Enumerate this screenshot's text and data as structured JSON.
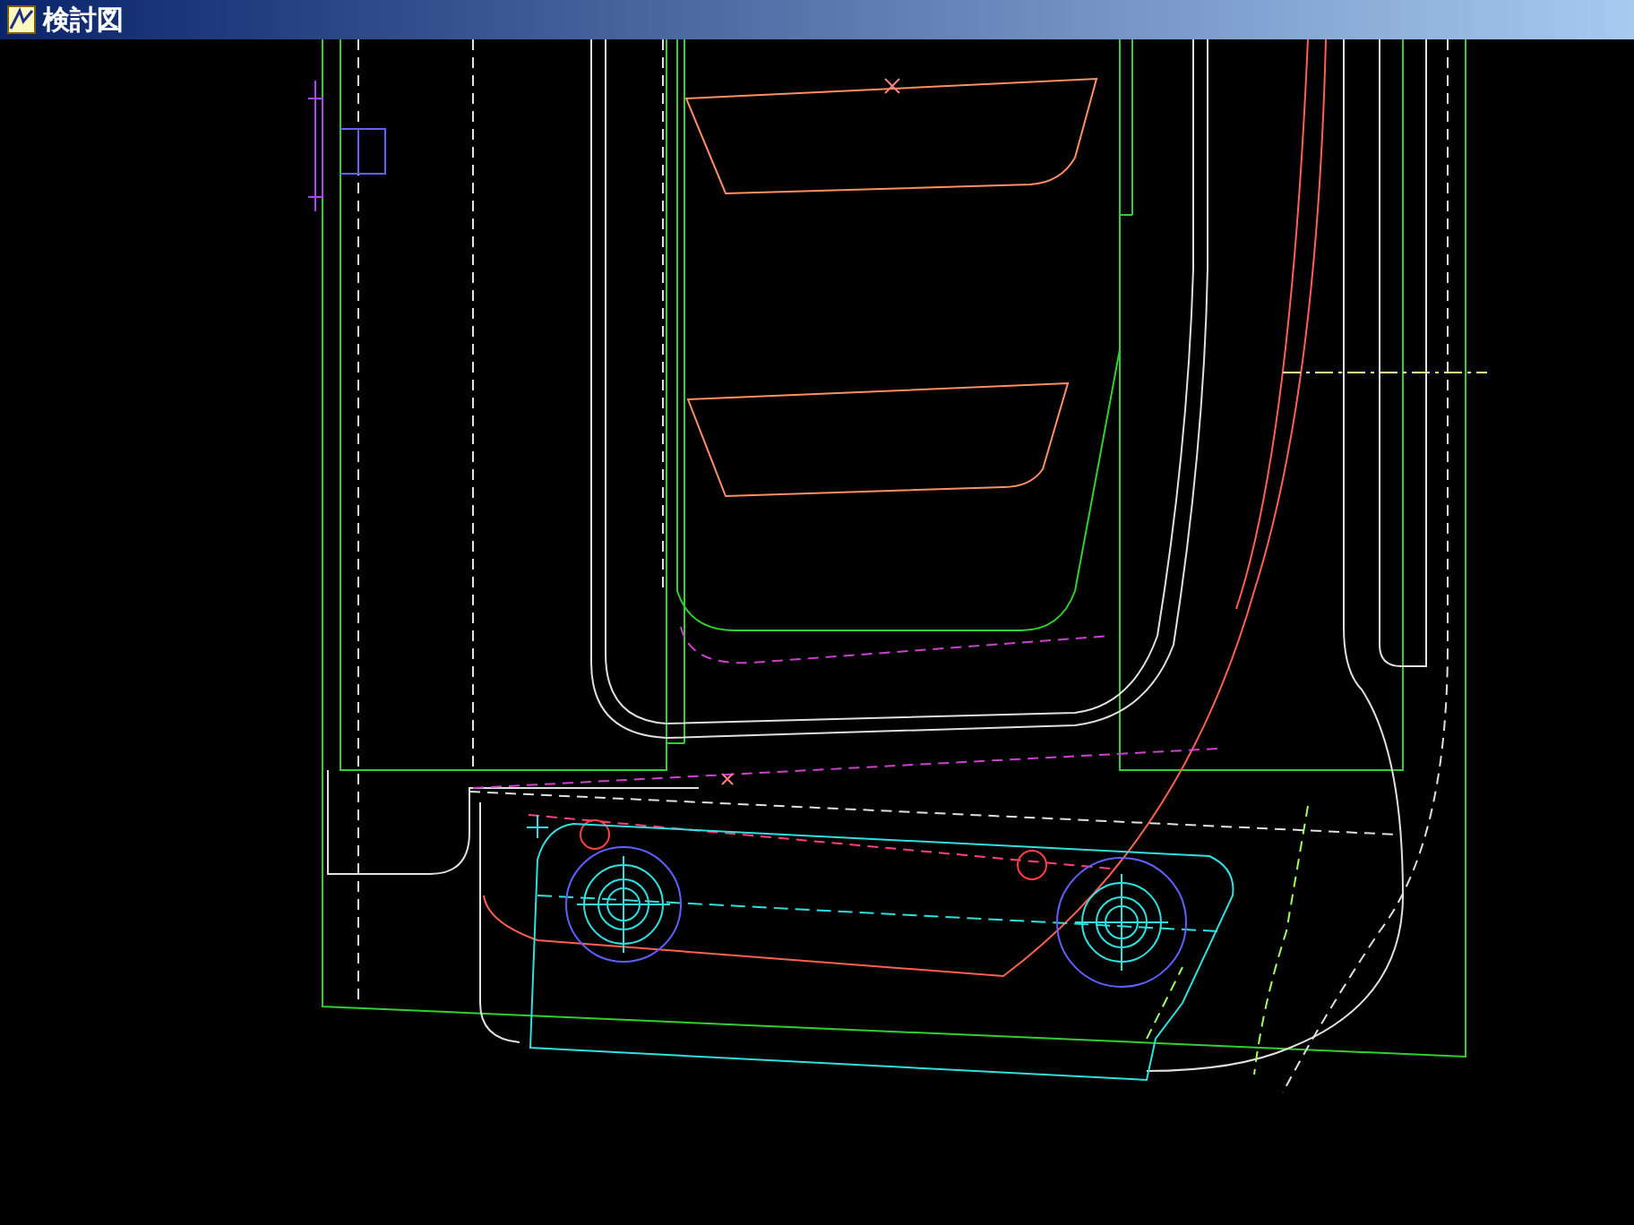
{
  "window": {
    "title": "検討図"
  }
}
